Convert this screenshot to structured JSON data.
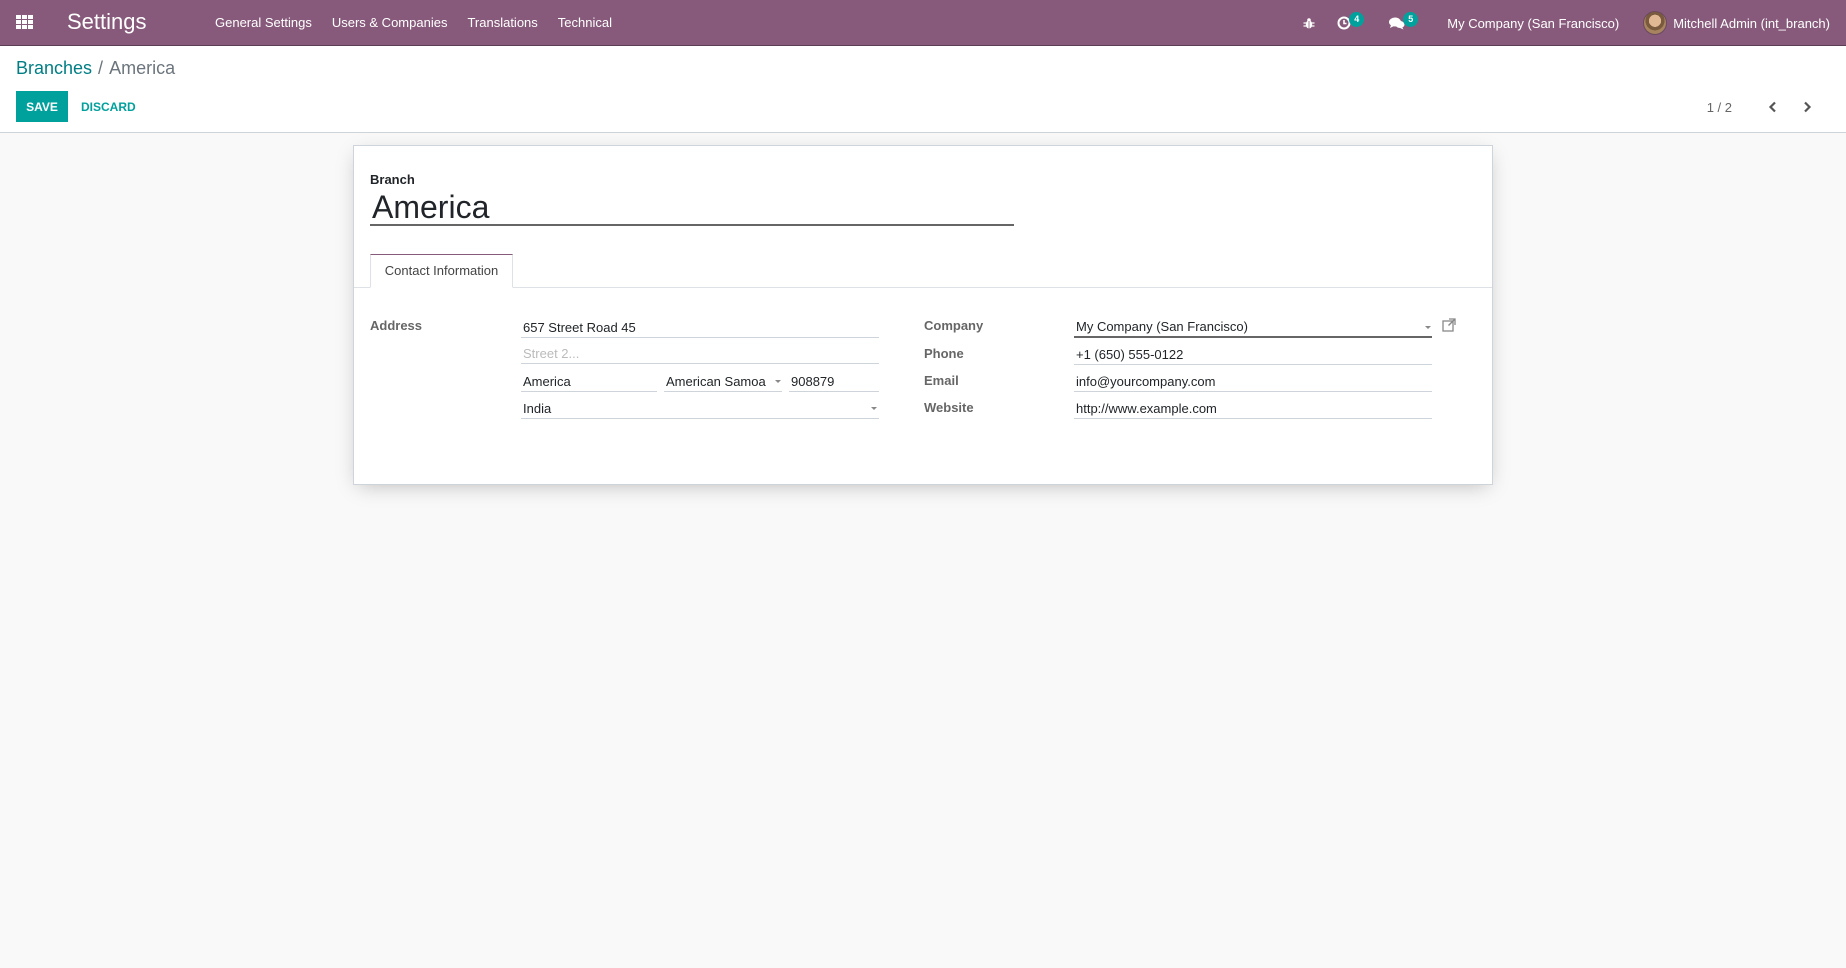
{
  "navbar": {
    "app_title": "Settings",
    "menu": [
      "General Settings",
      "Users & Companies",
      "Translations",
      "Technical"
    ],
    "activity_count": "4",
    "messages_count": "5",
    "company_switcher": "My Company (San Francisco)",
    "user_name": "Mitchell Admin (int_branch)",
    "icons": {
      "apps": "apps-grid-icon",
      "debug": "bug-icon",
      "activity": "clock-icon",
      "messages": "chat-icon"
    }
  },
  "control_panel": {
    "breadcrumb": {
      "parent": "Branches",
      "separator": "/",
      "current": "America"
    },
    "save_label": "Save",
    "discard_label": "Discard",
    "pager": {
      "value": "1 / 2",
      "prev_icon": "chevron-left-icon",
      "next_icon": "chevron-right-icon"
    }
  },
  "form": {
    "branch_label": "Branch",
    "branch_name": "America",
    "tabs": [
      "Contact Information"
    ],
    "address": {
      "label": "Address",
      "street": "657 Street Road 45",
      "street2_placeholder": "Street 2...",
      "city": "America",
      "state": "American Samoa",
      "zip": "908879",
      "country": "India"
    },
    "company": {
      "label": "Company",
      "value": "My Company (San Francisco)"
    },
    "phone": {
      "label": "Phone",
      "value": "+1 (650) 555-0122"
    },
    "email": {
      "label": "Email",
      "value": "info@yourcompany.com"
    },
    "website": {
      "label": "Website",
      "value": "http://www.example.com"
    }
  },
  "colors": {
    "brand": "#875A7B",
    "accent": "#00A09D",
    "link": "#017e84"
  }
}
